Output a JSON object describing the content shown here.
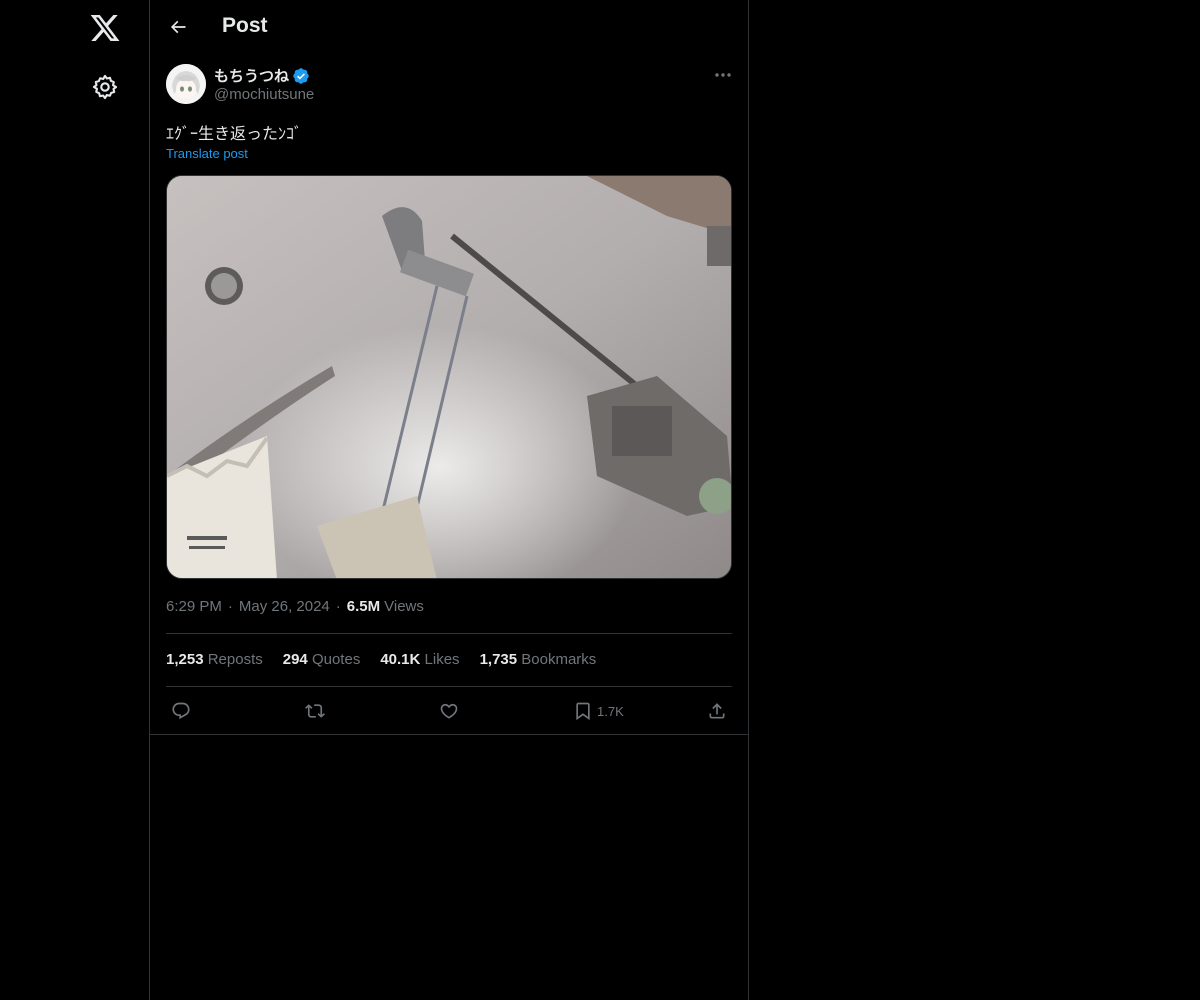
{
  "nav": {
    "logo_icon": "x-logo-icon",
    "settings_icon": "gear-icon"
  },
  "header": {
    "title": "Post",
    "back_icon": "arrow-left-icon"
  },
  "post": {
    "author": {
      "display_name": "もちうつね",
      "handle": "@mochiutsune",
      "verified": true
    },
    "text": "ｴｸﾞｰ生き返ったﾝｺﾞ",
    "translate_label": "Translate post",
    "time": "6:29 PM",
    "date": "May 26, 2024",
    "separator": "·",
    "views_count": "6.5M",
    "views_label": "Views",
    "stats": {
      "reposts_count": "1,253",
      "reposts_label": "Reposts",
      "quotes_count": "294",
      "quotes_label": "Quotes",
      "likes_count": "40.1K",
      "likes_label": "Likes",
      "bookmarks_count": "1,735",
      "bookmarks_label": "Bookmarks"
    },
    "actions": {
      "bookmark_count": "1.7K"
    }
  },
  "colors": {
    "background": "#000000",
    "text_primary": "#e7e9ea",
    "text_secondary": "#71767b",
    "accent": "#1d9bf0",
    "border": "#2f3336"
  }
}
